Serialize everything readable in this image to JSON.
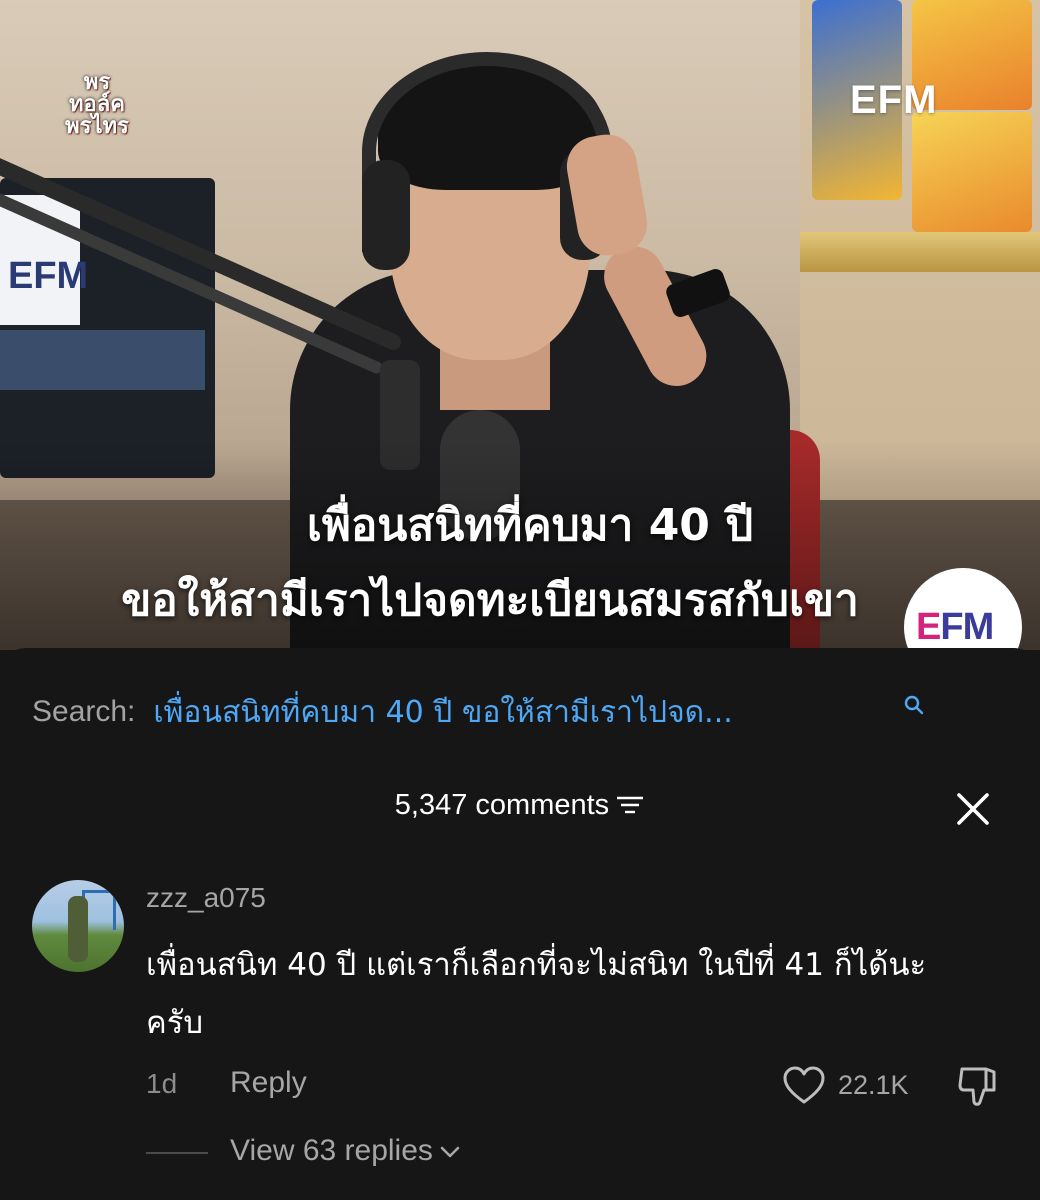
{
  "video": {
    "channel_logo_text": "พรทอล์คพรไทร",
    "watermark": "EFM",
    "monitor_logo": "EFM",
    "caption_line1": "เพื่อนสนิทที่คบมา 40 ปี",
    "caption_line2": "ขอให้สามีเราไปจดทะเบียนสมรสกับเขา",
    "badge_logo_e": "E",
    "badge_logo_fm": "FM"
  },
  "search": {
    "label": "Search:",
    "query": "เพื่อนสนิทที่คบมา 40 ปี ขอให้สามีเราไปจด..."
  },
  "comments": {
    "count_label": "5,347 comments"
  },
  "comment": {
    "username": "zzz_a075",
    "text": "เพื่อนสนิท 40 ปี แต่เราก็เลือกที่จะไม่สนิท ในปีที่ 41 ก็ได้นะครับ",
    "time": "1d",
    "reply_label": "Reply",
    "like_count": "22.1K",
    "view_replies_label": "View 63 replies"
  },
  "colors": {
    "panel_bg": "#161616",
    "search_query": "#4ea8f5",
    "muted_text": "#a6a6a6"
  },
  "icons": [
    "search-icon",
    "sort-icon",
    "close-icon",
    "heart-icon",
    "thumbs-down-icon",
    "chevron-down-icon"
  ]
}
